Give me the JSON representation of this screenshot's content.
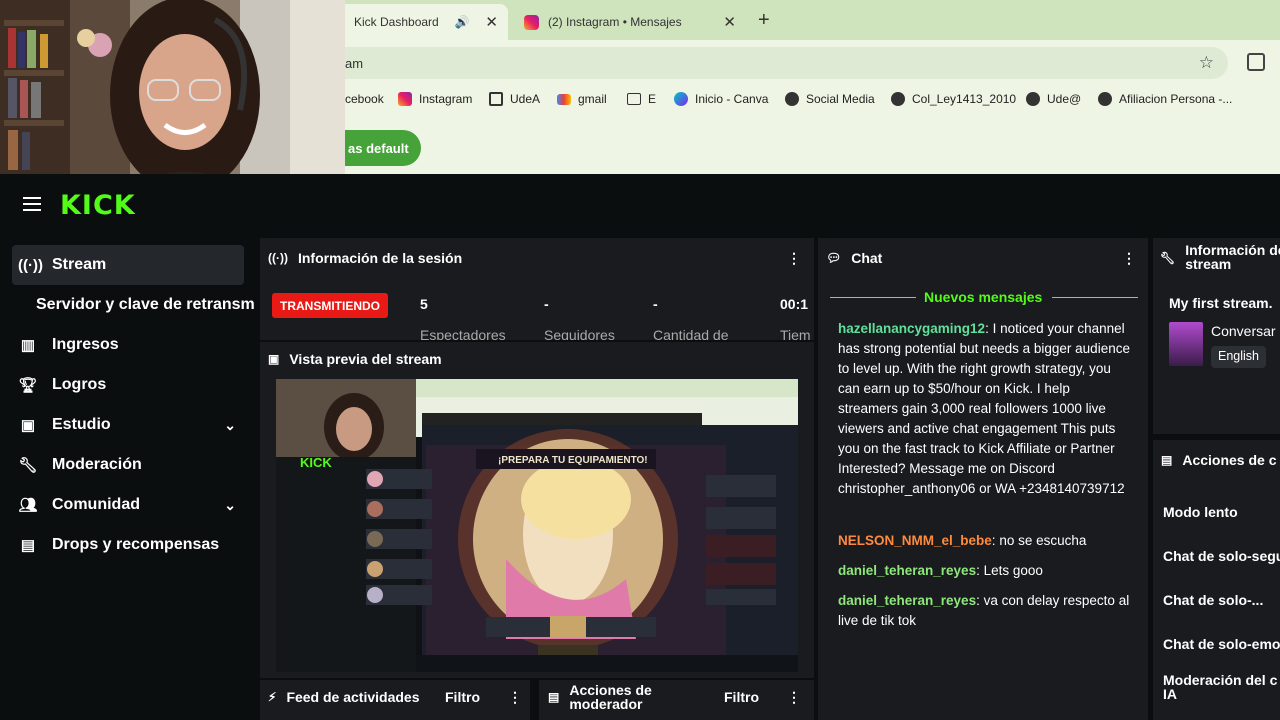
{
  "browser": {
    "tabs": [
      {
        "title": "Kick Dashboard",
        "active": true
      },
      {
        "title": "(2) Instagram • Mensajes",
        "active": false
      }
    ],
    "address": "am",
    "bookmarks": [
      {
        "label": "cebook",
        "icon": "facebook-icon"
      },
      {
        "label": "Instagram",
        "icon": "instagram-icon"
      },
      {
        "label": "UdeA",
        "icon": "udea-icon"
      },
      {
        "label": "gmail",
        "icon": "gmail-icon"
      },
      {
        "label": "E",
        "icon": "folder-icon"
      },
      {
        "label": "Inicio - Canva",
        "icon": "canva-icon"
      },
      {
        "label": "Social Media",
        "icon": "globe-icon"
      },
      {
        "label": "Col_Ley1413_2010",
        "icon": "globe-icon"
      },
      {
        "label": "Ude@",
        "icon": "globe-icon"
      },
      {
        "label": "Afiliacion Persona -...",
        "icon": "globe-icon"
      }
    ],
    "default_button": "as default"
  },
  "kick": {
    "logo": "KICK",
    "sidebar": [
      {
        "label": "Stream",
        "icon": "broadcast-icon",
        "active": true
      },
      {
        "label": "Servidor y clave de retransm",
        "icon": "",
        "active": false
      },
      {
        "label": "Ingresos",
        "icon": "chart-icon",
        "active": false
      },
      {
        "label": "Logros",
        "icon": "trophy-icon",
        "active": false
      },
      {
        "label": "Estudio",
        "icon": "studio-icon",
        "active": false,
        "expand": true
      },
      {
        "label": "Moderación",
        "icon": "wrench-icon",
        "active": false
      },
      {
        "label": "Comunidad",
        "icon": "community-icon",
        "active": false,
        "expand": true
      },
      {
        "label": "Drops y recompensas",
        "icon": "gift-icon",
        "active": false
      }
    ],
    "session": {
      "title": "Información de la sesión",
      "status": "TRANSMITIENDO",
      "stats": [
        {
          "value": "5",
          "label": "Espectadores"
        },
        {
          "value": "-",
          "label": "Seguidores"
        },
        {
          "value": "-",
          "label": "Cantidad de"
        },
        {
          "value": "00:1",
          "label": "Tiem"
        }
      ]
    },
    "preview": {
      "title": "Vista previa del stream",
      "game_banner": "¡PREPARA TU EQUIPAMIENTO!"
    },
    "feed": {
      "title": "Feed de actividades",
      "filter": "Filtro"
    },
    "modactions": {
      "title_line1": "Acciones de",
      "title_line2": "moderador",
      "filter": "Filtro"
    },
    "chat": {
      "title": "Chat",
      "new_messages": "Nuevos mensajes",
      "messages": [
        {
          "user": "hazellanancygaming12",
          "color": "#5ee19a",
          "text": "I noticed your channel has strong potential but needs a bigger audience to level up. With the right growth strategy, you can earn up to $50/hour on Kick. I help streamers gain 3,000 real followers 1000 live viewers and active chat engagement This puts you on the fast track to Kick Affiliate or Partner Interested? Message me on Discord christopher_anthony06 or WA +2348140739712"
        },
        {
          "user": "NELSON_NMM_el_bebe",
          "color": "#ff8a3d",
          "text": "no se escucha"
        },
        {
          "user": "daniel_teheran_reyes",
          "color": "#8ee77a",
          "text": "Lets gooo"
        },
        {
          "user": "daniel_teheran_reyes",
          "color": "#8ee77a",
          "text": "va con delay respecto al live de tik tok"
        }
      ]
    },
    "stream_info": {
      "title_line1": "Información de",
      "title_line2": "stream",
      "stream_title": "My first stream.",
      "category": "Conversar",
      "language": "English"
    },
    "chat_actions": {
      "title": "Acciones de c",
      "items": [
        "Modo lento",
        "Chat de solo-segu",
        "Chat de solo-...",
        "Chat de solo-emo",
        "Moderación del c",
        "IA"
      ]
    }
  }
}
